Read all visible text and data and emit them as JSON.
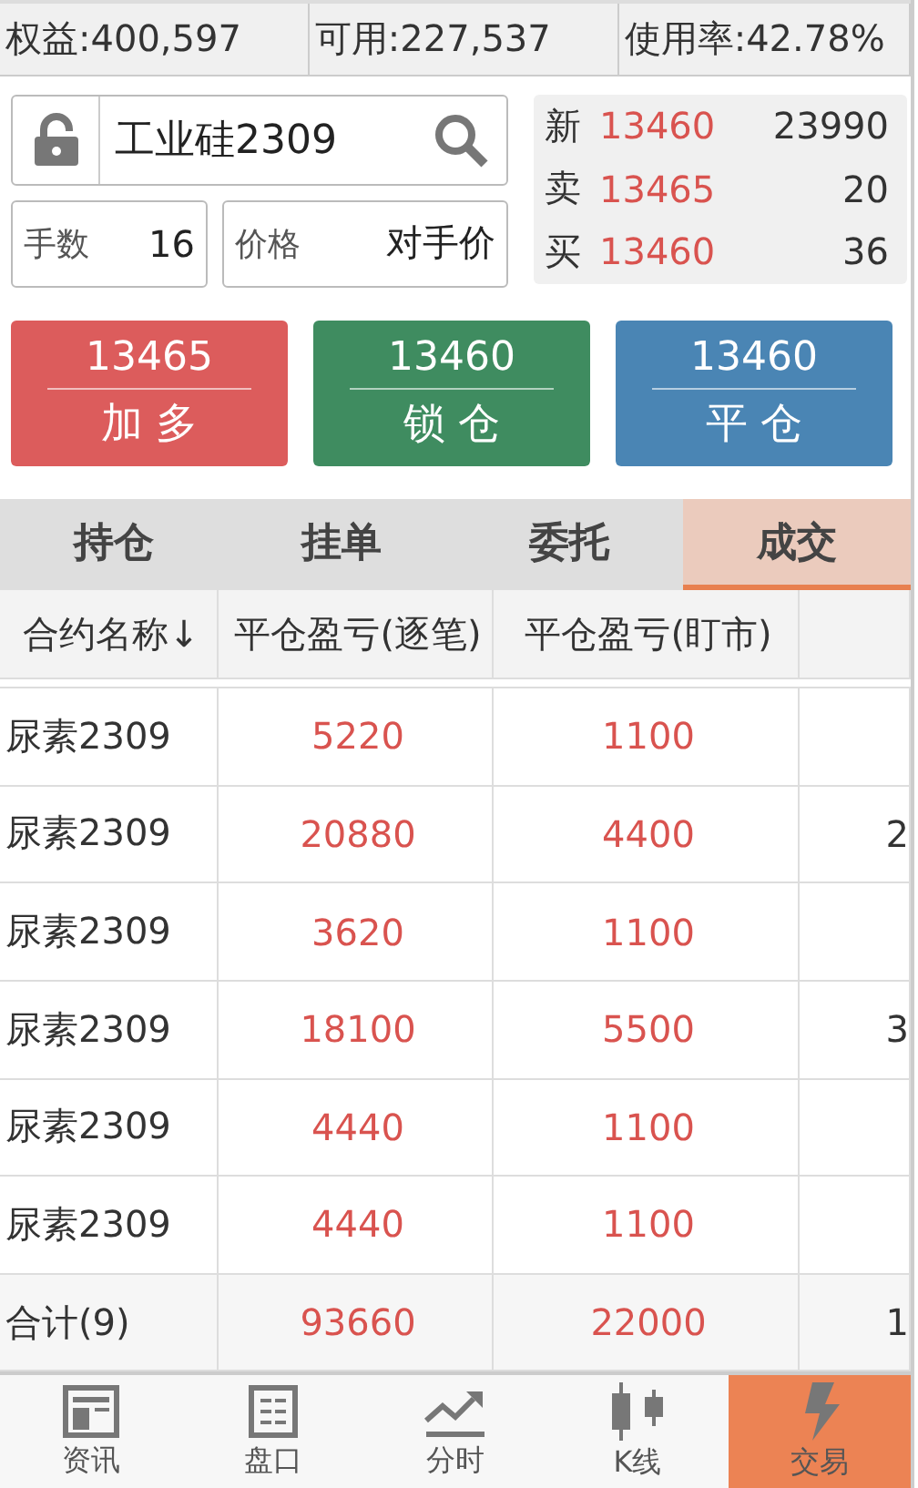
{
  "account": [
    {
      "label": "权益:400,597"
    },
    {
      "label": "可用:227,537"
    },
    {
      "label": "使用率:42.78%"
    }
  ],
  "contract": {
    "locked": false,
    "value": "工业硅2309"
  },
  "lots": {
    "label": "手数",
    "value": "16"
  },
  "price": {
    "label": "价格",
    "value": "对手价"
  },
  "quotes": [
    {
      "label": "新",
      "price": "13460",
      "volume": "23990"
    },
    {
      "label": "卖",
      "price": "13465",
      "volume": "20"
    },
    {
      "label": "买",
      "price": "13460",
      "volume": "36"
    }
  ],
  "actions": [
    {
      "kind": "buy",
      "price": "13465",
      "label": "加 多"
    },
    {
      "kind": "lock",
      "price": "13460",
      "label": "锁 仓"
    },
    {
      "kind": "close",
      "price": "13460",
      "label": "平 仓"
    }
  ],
  "tabs": [
    {
      "label": "持仓",
      "selected": false
    },
    {
      "label": "挂单",
      "selected": false
    },
    {
      "label": "委托",
      "selected": false
    },
    {
      "label": "成交",
      "selected": true
    }
  ],
  "table": {
    "columns": [
      "合约名称↓",
      "平仓盈亏(逐笔)",
      "平仓盈亏(盯市)"
    ],
    "rows": [
      {
        "name": "尿素2309",
        "pnl_trade": "5220",
        "pnl_mark": "1100"
      },
      {
        "name": "尿素2309",
        "pnl_trade": "20880",
        "pnl_mark": "4400",
        "column_4": "2"
      },
      {
        "name": "尿素2309",
        "pnl_trade": "3620",
        "pnl_mark": "1100"
      },
      {
        "name": "尿素2309",
        "pnl_trade": "18100",
        "pnl_mark": "5500",
        "column_4": "3"
      },
      {
        "name": "尿素2309",
        "pnl_trade": "4440",
        "pnl_mark": "1100"
      },
      {
        "name": "尿素2309",
        "pnl_trade": "4440",
        "pnl_mark": "1100"
      }
    ],
    "total": {
      "name": "合计(9)",
      "pnl_trade": "93660",
      "pnl_mark": "22000",
      "column_4": "1"
    }
  },
  "nav": [
    {
      "kind": "news",
      "label": "资讯",
      "selected": false
    },
    {
      "kind": "board",
      "label": "盘口",
      "selected": false
    },
    {
      "kind": "time",
      "label": "分时",
      "selected": false
    },
    {
      "kind": "kline",
      "label": "K线",
      "selected": false
    },
    {
      "kind": "trade",
      "label": "交易",
      "selected": true
    }
  ]
}
